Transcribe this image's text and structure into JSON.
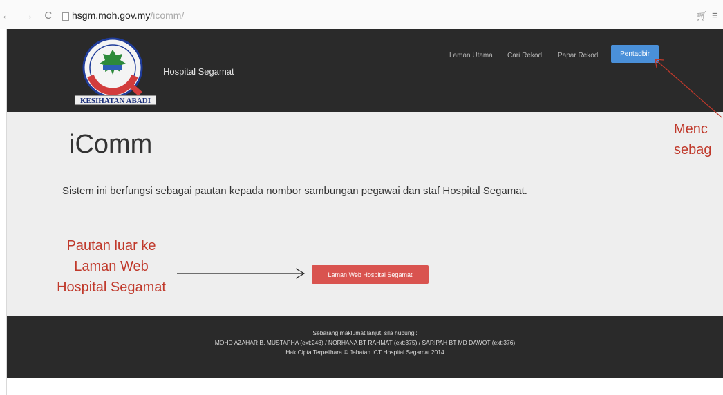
{
  "browser": {
    "url_host": "hsgm.moh.gov.my",
    "url_path": "/icomm/"
  },
  "header": {
    "logo_text": "KESIHATAN ABADI",
    "brand": "Hospital Segamat",
    "nav": [
      "Laman Utama",
      "Cari Rekod",
      "Papar Rekod"
    ],
    "admin_button": "Pentadbir"
  },
  "main": {
    "title": "iComm",
    "lead": "Sistem ini berfungsi sebagai pautan kepada nombor sambungan pegawai dan staf Hospital Segamat.",
    "website_button": "Laman Web Hospital Segamat"
  },
  "annotations": {
    "left_lines": [
      "Pautan luar ke",
      "Laman Web",
      "Hospital Segamat"
    ],
    "right_lines": [
      "Menc",
      "sebag"
    ]
  },
  "footer": {
    "line1": "Sebarang maklumat lanjut, sila hubungi:",
    "line2": "MOHD AZAHAR B. MUSTAPHA (ext:248) / NORHANA BT RAHMAT (ext:375) / SARIPAH BT MD DAWOT (ext:376)",
    "line3": "Hak Cipta Terpelihara © Jabatan ICT Hospital Segamat 2014"
  },
  "colors": {
    "header_bg": "#2a2a2a",
    "jumbotron_bg": "#eeeeee",
    "primary_button": "#4a90d9",
    "danger_button": "#d9534f",
    "annotation": "#c0392b"
  }
}
